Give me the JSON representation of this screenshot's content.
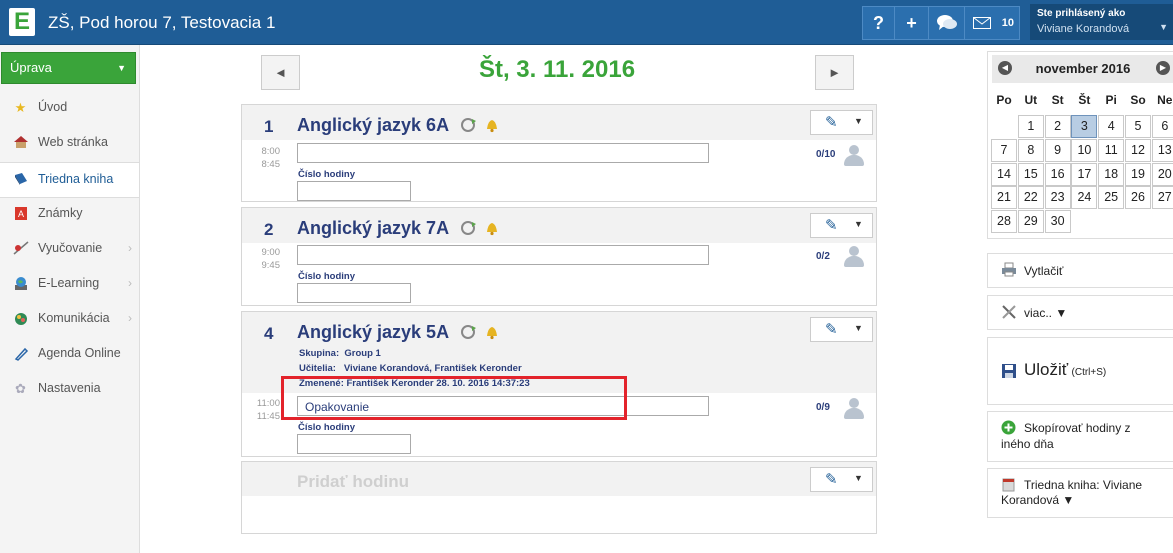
{
  "header": {
    "logo_letter": "E",
    "school": "ZŠ, Pod horou 7, Testovacia 1",
    "help_label": "?",
    "add_label": "+",
    "mail_count": "10",
    "user_caption": "Ste prihlásený ako",
    "user_name": "Viviane Korandová"
  },
  "sidebar": {
    "action_button": "Úprava",
    "items": [
      {
        "label": "Úvod",
        "icon": "star-icon"
      },
      {
        "label": "Web stránka",
        "icon": "house-icon"
      },
      {
        "label": "Triedna kniha",
        "icon": "book-icon"
      },
      {
        "label": "Známky",
        "icon": "grades-icon"
      },
      {
        "label": "Vyučovanie",
        "icon": "teaching-icon"
      },
      {
        "label": "E-Learning",
        "icon": "globe-icon"
      },
      {
        "label": "Komunikácia",
        "icon": "people-icon"
      },
      {
        "label": "Agenda Online",
        "icon": "pen-icon"
      },
      {
        "label": "Nastavenia",
        "icon": "settings-icon"
      }
    ]
  },
  "day": {
    "prev": "◄",
    "next": "►",
    "title": "Št, 3. 11. 2016"
  },
  "lessons": [
    {
      "number": "1",
      "subject": "Anglický jazyk  6A",
      "start": "8:00",
      "end": "8:45",
      "topic": "",
      "number_label": "Číslo hodiny",
      "attendance": "0/10"
    },
    {
      "number": "2",
      "subject": "Anglický jazyk  7A",
      "start": "9:00",
      "end": "9:45",
      "topic": "",
      "number_label": "Číslo hodiny",
      "attendance": "0/2"
    },
    {
      "number": "4",
      "subject": "Anglický jazyk  5A",
      "group_label": "Skupina:",
      "group_value": "Group 1",
      "teachers_label": "Učitelia:",
      "teachers_value": "Viviane Korandová, František Keronder",
      "changed": "Zmenené: František Keronder 28. 10. 2016 14:37:23",
      "start": "11:00",
      "end": "11:45",
      "topic": "Opakovanie",
      "number_label": "Číslo hodiny",
      "attendance": "0/9"
    }
  ],
  "add_lesson": "Pridať hodinu",
  "calendar": {
    "month": "november 2016",
    "weekdays": [
      "Po",
      "Ut",
      "St",
      "Št",
      "Pi",
      "So",
      "Ne"
    ],
    "weeks": [
      [
        "",
        "1",
        "2",
        "3",
        "4",
        "5",
        "6"
      ],
      [
        "7",
        "8",
        "9",
        "10",
        "11",
        "12",
        "13"
      ],
      [
        "14",
        "15",
        "16",
        "17",
        "18",
        "19",
        "20"
      ],
      [
        "21",
        "22",
        "23",
        "24",
        "25",
        "26",
        "27"
      ],
      [
        "28",
        "29",
        "30",
        "",
        "",
        "",
        ""
      ]
    ],
    "selected_day": "3"
  },
  "actions": {
    "print": "Vytlačiť",
    "more": "viac.. ▼",
    "save": "Uložiť",
    "save_shortcut": "(Ctrl+S)",
    "copy_line1": "Skopírovať hodiny z",
    "copy_line2": "iného dňa",
    "book_line1": "Triedna kniha: Viviane",
    "book_line2": "Korandová ▼"
  }
}
